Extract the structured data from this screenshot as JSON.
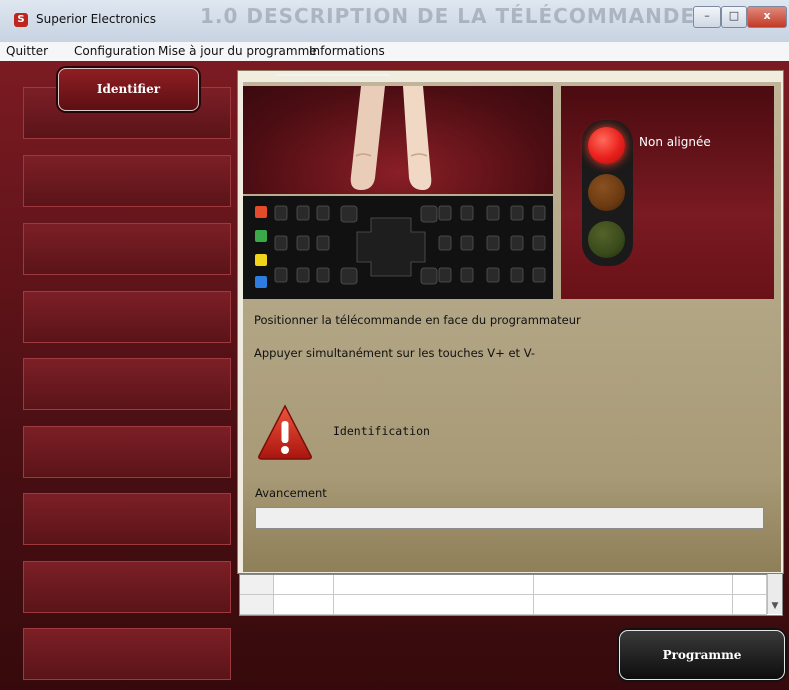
{
  "window": {
    "title": "Superior Electronics",
    "background_caption": "1.0 DESCRIPTION DE LA TÉLÉCOMMANDE",
    "minimize": "–",
    "maximize": "□",
    "close": "x"
  },
  "menu": {
    "items": [
      "Quitter",
      "Configuration",
      "Mise à jour du programme",
      "Informations"
    ]
  },
  "sidebar": {
    "identify_button": "Identifier"
  },
  "status": {
    "label": "Non alignée",
    "light_active": "red"
  },
  "instructions": {
    "line1": "Positionner la télécommande en face du programmateur",
    "line2": "Appuyer simultanément sur les touches V+ et V-"
  },
  "identification": {
    "icon": "warning-icon",
    "label": "Identification"
  },
  "progress": {
    "label": "Avancement",
    "value": 0
  },
  "actions": {
    "programme_button": "Programme"
  },
  "colors": {
    "accent": "#7c1a22",
    "lamp_red": "#e8201c",
    "lamp_amber": "#6b3a12",
    "lamp_green": "#3a4a1a"
  }
}
